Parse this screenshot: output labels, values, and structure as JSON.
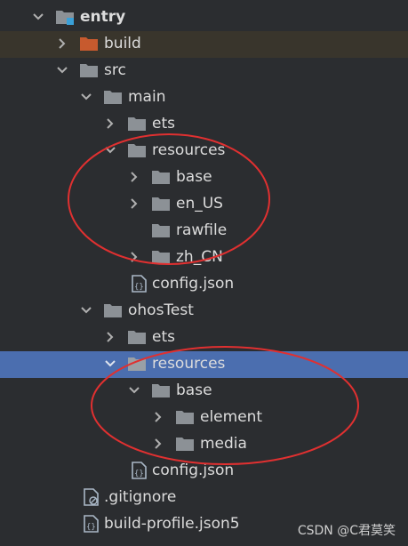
{
  "tree": {
    "rows": [
      {
        "label": "entry",
        "bold": true
      },
      {
        "label": "build"
      },
      {
        "label": "src"
      },
      {
        "label": "main"
      },
      {
        "label": "ets"
      },
      {
        "label": "resources"
      },
      {
        "label": "base"
      },
      {
        "label": "en_US"
      },
      {
        "label": "rawfile"
      },
      {
        "label": "zh_CN"
      },
      {
        "label": "config.json"
      },
      {
        "label": "ohosTest"
      },
      {
        "label": "ets"
      },
      {
        "label": "resources"
      },
      {
        "label": "base"
      },
      {
        "label": "element"
      },
      {
        "label": "media"
      },
      {
        "label": "config.json"
      },
      {
        "label": ".gitignore"
      },
      {
        "label": "build-profile.json5"
      }
    ]
  },
  "watermark": "CSDN @C君莫笑",
  "colors": {
    "background": "#2b2d30",
    "selected_row": "#4b6eaf",
    "hover_row": "#39352c",
    "folder": "#8c9196",
    "build_folder": "#c75a2e",
    "annotation": "#e03030"
  }
}
